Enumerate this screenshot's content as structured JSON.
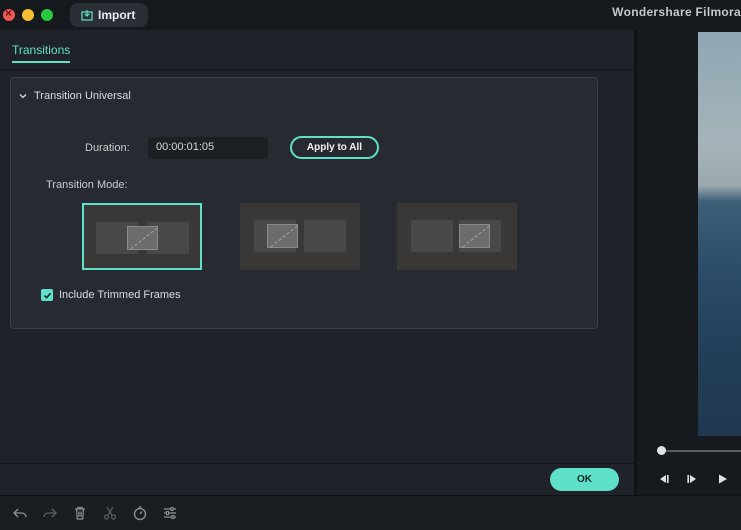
{
  "titlebar": {
    "import_label": "Import",
    "app_title": "Wondershare Filmora"
  },
  "tabs": {
    "transitions_label": "Transitions"
  },
  "section": {
    "title": "Transition Universal",
    "duration_label": "Duration:",
    "duration_value": "00:00:01:05",
    "apply_all_label": "Apply to All",
    "mode_label": "Transition Mode:",
    "modes": [
      {
        "icon": "transition-mode-overlap-icon",
        "selected": true
      },
      {
        "icon": "transition-mode-prefix-icon",
        "selected": false
      },
      {
        "icon": "transition-mode-postfix-icon",
        "selected": false
      }
    ],
    "include_trimmed_label": "Include Trimmed Frames",
    "include_trimmed_checked": true
  },
  "footer": {
    "ok_label": "OK"
  },
  "preview": {
    "playback": {
      "progress": 0
    }
  },
  "toolbar_icons": [
    "undo-icon",
    "redo-icon",
    "delete-icon",
    "cut-icon",
    "speed-icon",
    "adjust-icon"
  ],
  "colors": {
    "accent": "#5fe0c8",
    "panel": "#1f2329",
    "section": "#272b31",
    "titlebar": "#15181c"
  }
}
